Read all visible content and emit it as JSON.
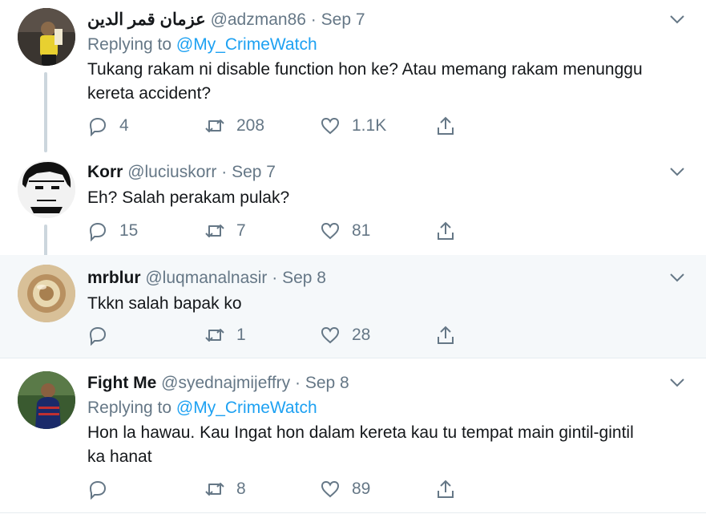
{
  "tweets": [
    {
      "name": "عزمان قمر الدين",
      "handle": "@adzman86",
      "date": "Sep 7",
      "replying_prefix": "Replying to",
      "replying_to": "@My_CrimeWatch",
      "text_lines": [
        "Tukang rakam ni disable function hon ke? Atau memang rakam menunggu",
        "kereta accident?"
      ],
      "replies": "4",
      "retweets": "208",
      "likes": "1.1K"
    },
    {
      "name": "Korr",
      "handle": "@luciuskorr",
      "date": "Sep 7",
      "text_lines": [
        "Eh? Salah perakam pulak?"
      ],
      "replies": "15",
      "retweets": "7",
      "likes": "81"
    },
    {
      "name": "mrblur",
      "handle": "@luqmanalnasir",
      "date": "Sep 8",
      "text_lines": [
        "Tkkn salah bapak ko"
      ],
      "replies": "",
      "retweets": "1",
      "likes": "28"
    },
    {
      "name": "Fight Me",
      "handle": "@syednajmijeffry",
      "date": "Sep 8",
      "replying_prefix": "Replying to",
      "replying_to": "@My_CrimeWatch",
      "text_lines": [
        "Hon la hawau. Kau Ingat hon dalam kereta kau tu tempat main gintil-gintil",
        "ka hanat"
      ],
      "replies": "",
      "retweets": "8",
      "likes": "89"
    }
  ],
  "separator": "·",
  "colors": {
    "link": "#1da1f2",
    "muted": "#657786",
    "text": "#14171a",
    "highlight_bg": "#f5f8fa",
    "thread_line": "#ccd6dd"
  },
  "icons": [
    "reply-icon",
    "retweet-icon",
    "like-icon",
    "share-icon",
    "chevron-down-icon"
  ]
}
